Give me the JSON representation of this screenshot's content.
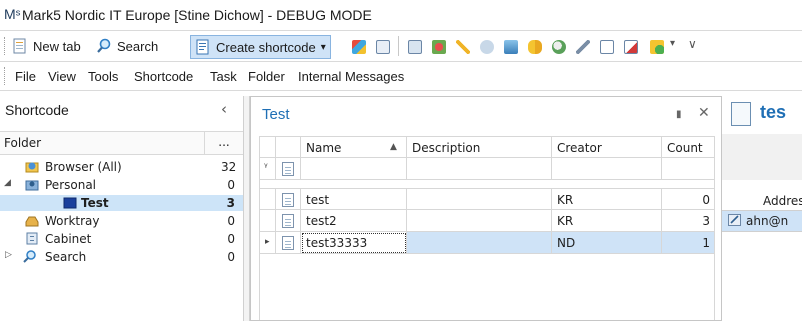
{
  "window": {
    "logo_glyph": "Mˢ",
    "title": "Mark5 Nordic IT Europe [Stine Dichow] - DEBUG MODE"
  },
  "toolbar": {
    "new_tab_label": "New tab",
    "search_label": "Search",
    "create_shortcode_label": "Create shortcode",
    "dropdown_glyph": "▾",
    "overflow_glyph": "∨"
  },
  "menu": {
    "items": [
      "File",
      "View",
      "Tools",
      "Shortcode",
      "Task",
      "Folder",
      "Internal Messages"
    ]
  },
  "left_panel": {
    "header": "Shortcode",
    "collapse_glyph": "‹",
    "folder_label": "Folder",
    "folder_more": "...",
    "tree": [
      {
        "label": "Browser (All)",
        "count": "32"
      },
      {
        "label": "Personal",
        "count": "0"
      },
      {
        "label": "Test",
        "count": "3"
      },
      {
        "label": "Worktray",
        "count": "0"
      },
      {
        "label": "Cabinet",
        "count": "0"
      },
      {
        "label": "Search",
        "count": "0"
      }
    ]
  },
  "center_panel": {
    "title": "Test",
    "pin_glyph": "▮",
    "close_glyph": "✕",
    "sort_glyph": "▲",
    "filter_glyph": "ᵞ",
    "row_indicator_glyph": "▸",
    "columns": [
      "Name",
      "Description",
      "Creator",
      "Count"
    ],
    "rows": [
      {
        "name": "test",
        "description": "",
        "creator": "KR",
        "count": "0"
      },
      {
        "name": "test2",
        "description": "",
        "creator": "KR",
        "count": "3"
      },
      {
        "name": "test33333",
        "description": "",
        "creator": "ND",
        "count": "1"
      }
    ]
  },
  "right_panel": {
    "title": "tes",
    "column_header": "Addres",
    "row_value": "ahn@n"
  },
  "colors": {
    "accent_blue": "#1f6fb5",
    "selection_blue": "#cde4f8",
    "toolbar_active": "#cfe3f7"
  }
}
